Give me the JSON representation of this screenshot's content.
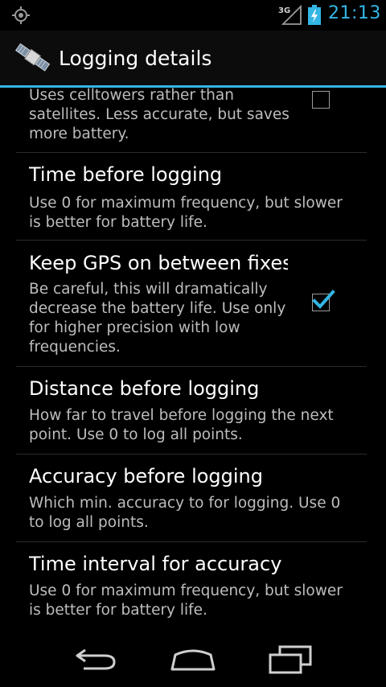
{
  "status_bar": {
    "time": "21:13",
    "network_type": "3G",
    "accent_color": "#33b5e5",
    "icons": [
      "gps-icon",
      "signal-icon",
      "battery-charging-icon"
    ]
  },
  "action_bar": {
    "title": "Logging details",
    "app_icon": "satellite-icon"
  },
  "preferences": [
    {
      "title": "",
      "summary": "Uses celltowers rather than satellites. Less accurate, but saves more battery.",
      "checkbox": true,
      "checked": false
    },
    {
      "title": "Time before logging",
      "summary": "Use 0 for maximum frequency, but slower is better for battery life.",
      "checkbox": false
    },
    {
      "title": "Keep GPS on between fixes",
      "summary": "Be careful, this will dramatically decrease the battery life. Use only for higher precision with low frequencies.",
      "checkbox": true,
      "checked": true
    },
    {
      "title": "Distance before logging",
      "summary": "How far to travel before logging the next point. Use 0 to log all points.",
      "checkbox": false
    },
    {
      "title": "Accuracy before logging",
      "summary": "Which min. accuracy to for logging. Use 0 to log all points.",
      "checkbox": false
    },
    {
      "title": "Time interval for accuracy",
      "summary": "Use 0 for maximum frequency, but slower is better for battery life.",
      "checkbox": false
    }
  ],
  "nav_bar": {
    "icons": [
      "back-icon",
      "home-icon",
      "recent-apps-icon"
    ]
  }
}
